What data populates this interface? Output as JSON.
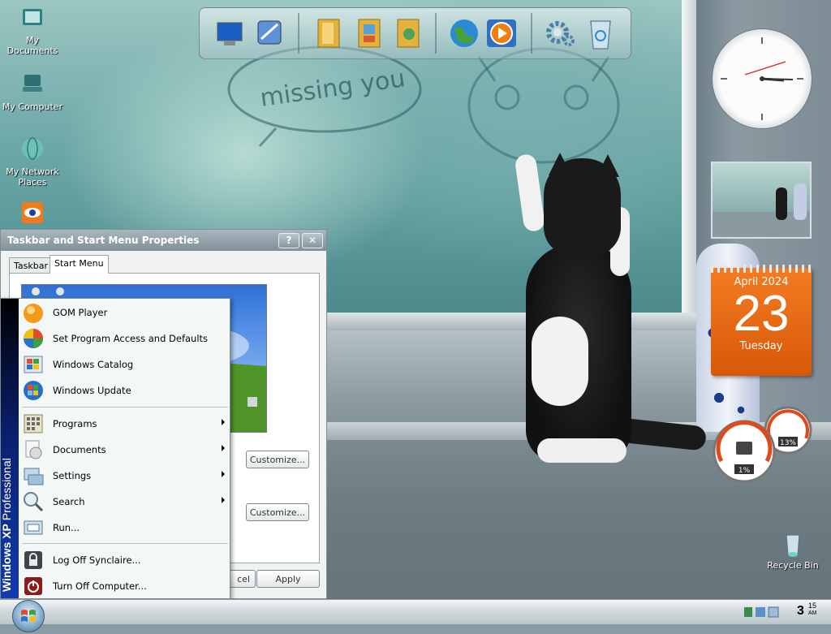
{
  "desktop": {
    "icons": [
      {
        "label": "My Documents"
      },
      {
        "label": "My Computer"
      },
      {
        "label": "My Network Places"
      }
    ],
    "recycle_bin": {
      "label": "Recycle Bin"
    },
    "wallpaper_text": "missing you"
  },
  "quick_launch": {
    "items": [
      "monitor-icon",
      "network-settings-icon",
      "folder-icon",
      "pictures-folder-icon",
      "music-folder-icon",
      "internet-globe-icon",
      "media-player-icon",
      "settings-gears-icon",
      "recycle-bin-icon"
    ]
  },
  "gadgets": {
    "calendar": {
      "month_year": "April 2024",
      "day": "23",
      "weekday": "Tuesday"
    },
    "meters": {
      "cpu": "1%",
      "memory": "13%"
    }
  },
  "dialog": {
    "title": "Taskbar and Start Menu Properties",
    "help_button": "?",
    "close_button": "✕",
    "tabs": [
      {
        "label": "Taskbar"
      },
      {
        "label": "Start Menu"
      }
    ],
    "customize_1": "Customize...",
    "customize_2": "Customize...",
    "cancel_partial": "cel",
    "apply": "Apply"
  },
  "start_menu": {
    "band_brand": "Windows XP",
    "band_edition": "Professional",
    "pinned": [
      {
        "label": "GOM Player"
      },
      {
        "label": "Set Program Access and Defaults"
      },
      {
        "label": "Windows Catalog"
      },
      {
        "label": "Windows Update"
      }
    ],
    "programs": {
      "label": "Programs"
    },
    "documents": {
      "label": "Documents"
    },
    "settings": {
      "label": "Settings"
    },
    "search": {
      "label": "Search"
    },
    "run": {
      "label": "Run..."
    },
    "logoff": {
      "label": "Log Off Synclaire..."
    },
    "shutdown": {
      "label": "Turn Off Computer..."
    }
  },
  "taskbar": {
    "clock_hour": "3",
    "clock_min": "15",
    "clock_ampm": "AM"
  }
}
